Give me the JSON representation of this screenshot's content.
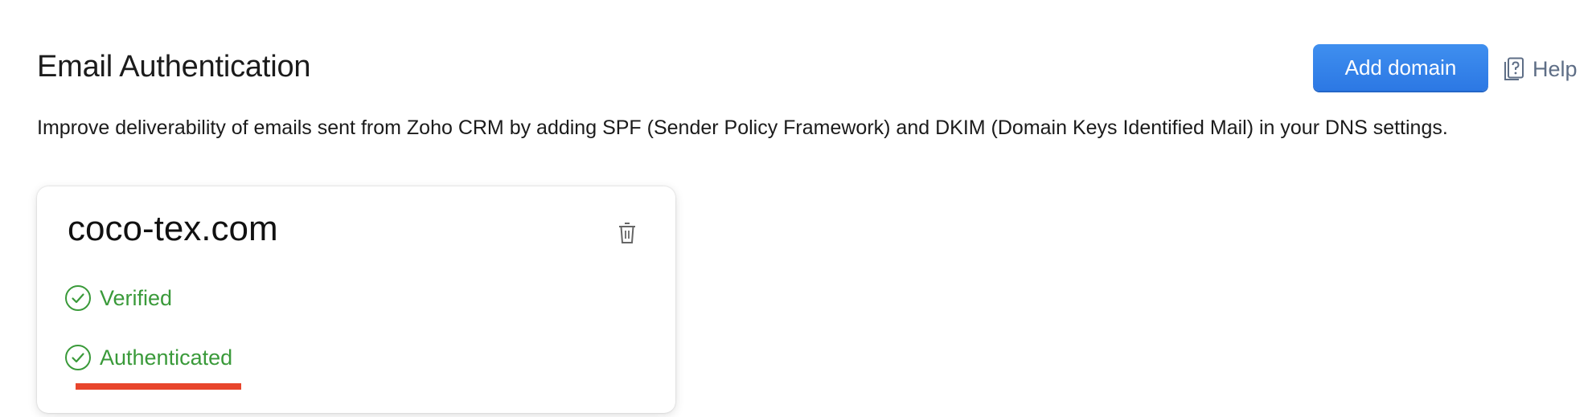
{
  "header": {
    "title": "Email Authentication",
    "add_domain_label": "Add domain",
    "help_label": "Help",
    "accent_color": "#2c78e4"
  },
  "description": "Improve deliverability of emails sent from Zoho CRM by adding SPF (Sender Policy Framework) and DKIM (Domain Keys Identified Mail) in your DNS settings.",
  "domain_card": {
    "domain": "coco-tex.com",
    "statuses": [
      {
        "label": "Verified",
        "icon": "check-circle-icon",
        "color": "#3a9a3a"
      },
      {
        "label": "Authenticated",
        "icon": "check-circle-icon",
        "color": "#3a9a3a"
      }
    ]
  },
  "annotation": {
    "underline_color": "#e8452c"
  }
}
